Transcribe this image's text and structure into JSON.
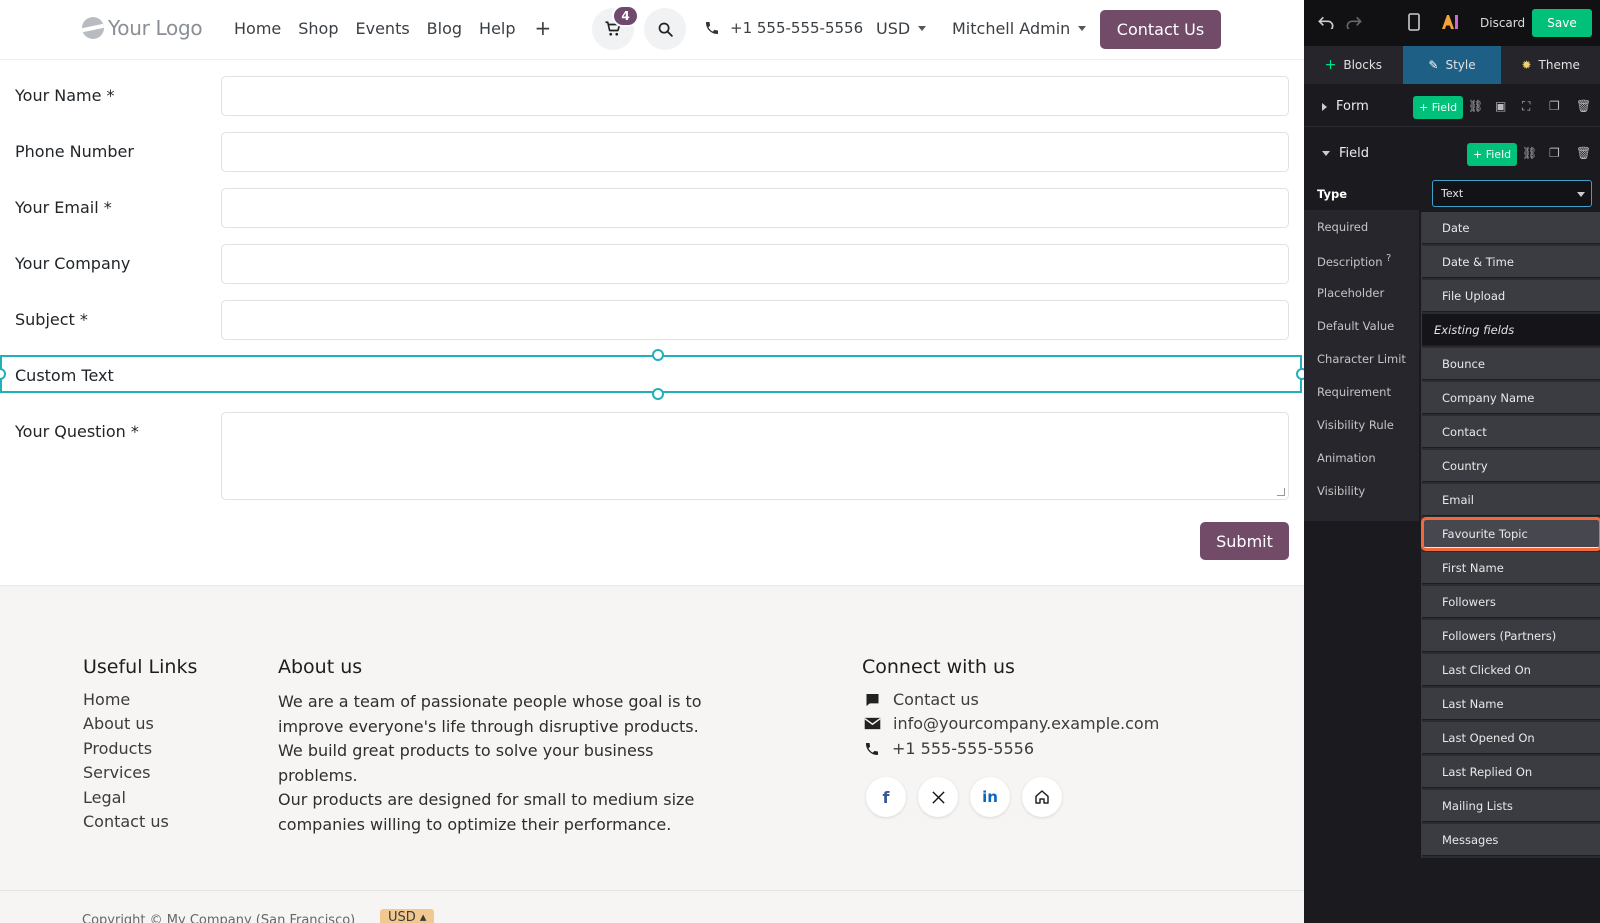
{
  "site": {
    "logo_text": "Your Logo",
    "nav_links": [
      "Home",
      "Shop",
      "Events",
      "Blog",
      "Help"
    ],
    "nav_plus": "+",
    "cart_count": "4",
    "phone": "+1 555-555-5556",
    "currency": "USD",
    "user": "Mitchell Admin",
    "contact_button": "Contact Us"
  },
  "form": {
    "fields": [
      {
        "label": "Your Name *"
      },
      {
        "label": "Phone Number"
      },
      {
        "label": "Your Email *"
      },
      {
        "label": "Your Company"
      },
      {
        "label": "Subject *"
      },
      {
        "label": "Custom Text"
      },
      {
        "label": "Your Question *"
      }
    ],
    "submit_label": "Submit"
  },
  "footer": {
    "useful_links_title": "Useful Links",
    "useful_links": [
      "Home",
      "About us",
      "Products",
      "Services",
      "Legal",
      "Contact us"
    ],
    "about_title": "About us",
    "about_p1": "We are a team of passionate people whose goal is to improve everyone's life through disruptive products. We build great products to solve your business problems.",
    "about_p2": "Our products are designed for small to medium size companies willing to optimize their performance.",
    "connect_title": "Connect with us",
    "connect_contact": "Contact us",
    "connect_email": "info@yourcompany.example.com",
    "connect_phone": "+1 555-555-5556",
    "social": [
      "facebook-icon",
      "x-icon",
      "linkedin-icon",
      "home-icon"
    ],
    "copyright": "Copyright © My Company (San Francisco)",
    "currency_pill": "USD ▴"
  },
  "editor": {
    "discard_label": "Discard",
    "save_label": "Save",
    "tabs": {
      "blocks": "Blocks",
      "style": "Style",
      "theme": "Theme"
    },
    "form_section": "Form",
    "field_section": "Field",
    "add_field_label": "+ Field",
    "type_label": "Type",
    "type_value": "Text",
    "properties": [
      "Required",
      "Description",
      "Placeholder",
      "Default Value",
      "Character Limit",
      "Requirement",
      "Visibility Rule",
      "Animation",
      "Visibility"
    ],
    "description_hint": "?",
    "dropdown_items": [
      "Date",
      "Date & Time",
      "File Upload"
    ],
    "existing_fields_header": "Existing fields",
    "existing_fields": [
      "Bounce",
      "Company Name",
      "Contact",
      "Country",
      "Email",
      "Favourite Topic",
      "First Name",
      "Followers",
      "Followers (Partners)",
      "Last Clicked On",
      "Last Name",
      "Last Opened On",
      "Last Replied On",
      "Mailing Lists",
      "Messages"
    ],
    "highlighted_item": "Favourite Topic"
  },
  "colors": {
    "brand": "#714b67",
    "selection": "#21b0b8",
    "editor_bg": "#1a1a1f",
    "save_green": "#00c07a",
    "highlight_orange": "#f26a3c"
  }
}
